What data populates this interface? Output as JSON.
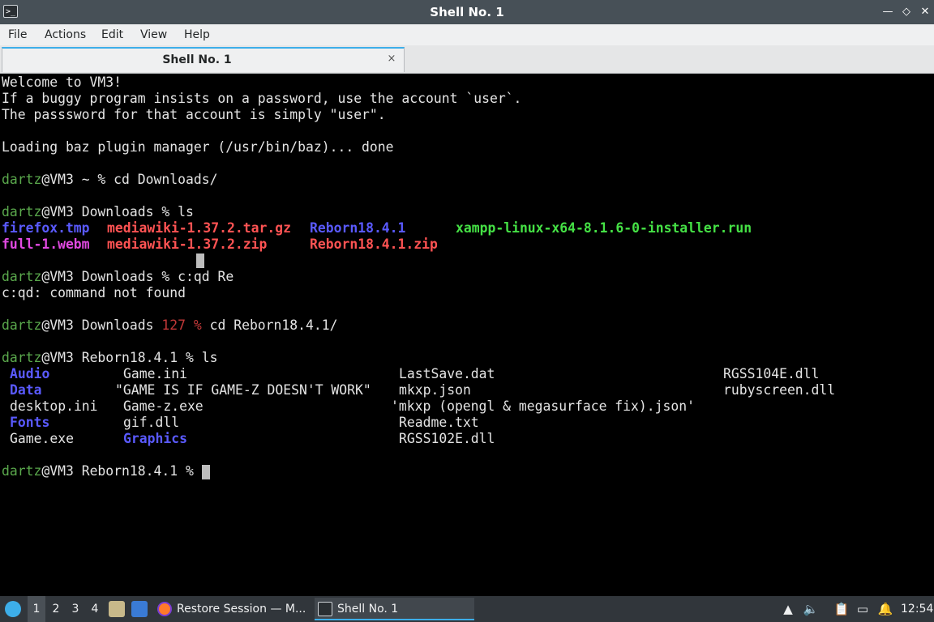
{
  "window": {
    "title": "Shell No. 1",
    "controls": {
      "minimize": "—",
      "maximize": "◇",
      "close": "✕"
    }
  },
  "menu": [
    "File",
    "Actions",
    "Edit",
    "View",
    "Help"
  ],
  "tab": {
    "label": "Shell No. 1",
    "close": "×"
  },
  "terminal": {
    "welcome": [
      "Welcome to VM3!",
      "If a buggy program insists on a password, use the account `user`.",
      "The passsword for that account is simply \"user\".",
      "",
      "Loading baz plugin manager (/usr/bin/baz)... done"
    ],
    "user": "dartz",
    "host": "@VM3",
    "cmd1": {
      "dir": " ~ % ",
      "cmd": "cd Downloads/"
    },
    "cmd2": {
      "dir": " Downloads % ",
      "cmd": "ls"
    },
    "ls1": {
      "row1": [
        "firefox.tmp",
        "mediawiki-1.37.2.tar.gz",
        "Reborn18.4.1",
        "xampp-linux-x64-8.1.6-0-installer.run"
      ],
      "row2": [
        "full-1.webm",
        "mediawiki-1.37.2.zip",
        "Reborn18.4.1.zip"
      ]
    },
    "cmd3": {
      "dir": " Downloads % ",
      "cmd": "c:qd Re"
    },
    "err": "c:qd: command not found",
    "cmd4": {
      "dir": " Downloads ",
      "status": "127 %",
      "cmd": " cd Reborn18.4.1/"
    },
    "cmd5": {
      "dir": " Reborn18.4.1 % ",
      "cmd": "ls"
    },
    "ls2": {
      "col1": [
        "Audio",
        "Data",
        "desktop.ini",
        "Fonts",
        "Game.exe"
      ],
      "col2": [
        "Game.ini",
        "\"GAME IS IF GAME-Z DOESN'T WORK\"",
        "Game-z.exe",
        "gif.dll",
        "Graphics"
      ],
      "col3": [
        "LastSave.dat",
        "mkxp.json",
        "'mkxp (opengl & megasurface fix).json'",
        "Readme.txt",
        "RGSS102E.dll"
      ],
      "col4": [
        "RGSS104E.dll",
        "rubyscreen.dll"
      ]
    },
    "prompt_final": {
      "dir": " Reborn18.4.1 % "
    }
  },
  "taskbar": {
    "desktops": [
      "1",
      "2",
      "3",
      "4"
    ],
    "tasks": [
      {
        "label": "Restore Session — M...",
        "icon": "firefox-icon"
      },
      {
        "label": "Shell No. 1",
        "icon": "terminal-icon"
      }
    ],
    "clock": "12:54"
  },
  "colors": {
    "prompt_green": "#5aa84c",
    "dir_blue": "#5a5aff",
    "archive_red": "#ff5353",
    "exec_green": "#45e145",
    "media_magenta": "#e24ae2",
    "accent": "#3daee9"
  }
}
